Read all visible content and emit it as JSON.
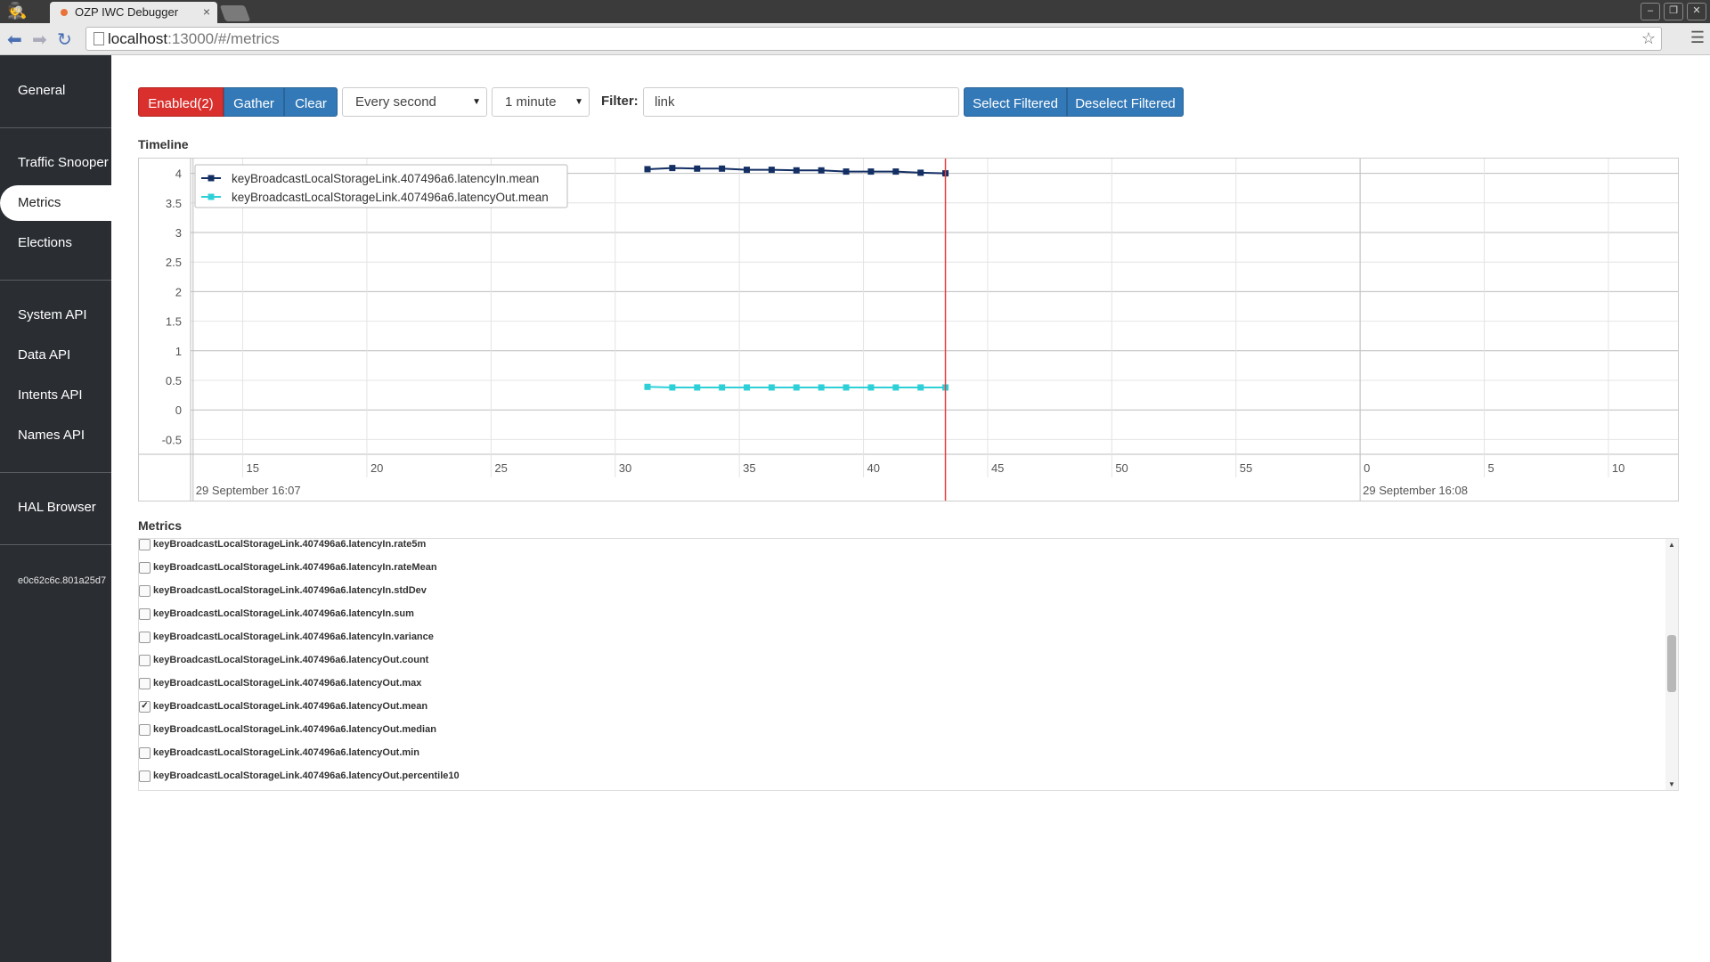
{
  "browser": {
    "tab_title": "OZP IWC Debugger",
    "tab_close": "×",
    "url_host": "localhost",
    "url_rest": ":13000/#/metrics"
  },
  "sidebar": {
    "items": [
      {
        "label": "General"
      },
      {
        "label": "Traffic Snooper"
      },
      {
        "label": "Metrics",
        "active": true
      },
      {
        "label": "Elections"
      },
      {
        "label": "System API"
      },
      {
        "label": "Data API"
      },
      {
        "label": "Intents API"
      },
      {
        "label": "Names API"
      },
      {
        "label": "HAL Browser"
      }
    ],
    "instance_id": "e0c62c6c.801a25d7"
  },
  "controls": {
    "enabled_label": "Enabled(2)",
    "gather_label": "Gather",
    "clear_label": "Clear",
    "interval_select": "Every second",
    "window_select": "1 minute",
    "filter_label": "Filter:",
    "filter_value": "link",
    "select_filtered_label": "Select Filtered",
    "deselect_filtered_label": "Deselect Filtered"
  },
  "sections": {
    "timeline_title": "Timeline",
    "metrics_title": "Metrics"
  },
  "metrics_list": [
    {
      "name": "keyBroadcastLocalStorageLink.407496a6.latencyIn.rate5m",
      "checked": false
    },
    {
      "name": "keyBroadcastLocalStorageLink.407496a6.latencyIn.rateMean",
      "checked": false
    },
    {
      "name": "keyBroadcastLocalStorageLink.407496a6.latencyIn.stdDev",
      "checked": false
    },
    {
      "name": "keyBroadcastLocalStorageLink.407496a6.latencyIn.sum",
      "checked": false
    },
    {
      "name": "keyBroadcastLocalStorageLink.407496a6.latencyIn.variance",
      "checked": false
    },
    {
      "name": "keyBroadcastLocalStorageLink.407496a6.latencyOut.count",
      "checked": false
    },
    {
      "name": "keyBroadcastLocalStorageLink.407496a6.latencyOut.max",
      "checked": false
    },
    {
      "name": "keyBroadcastLocalStorageLink.407496a6.latencyOut.mean",
      "checked": true
    },
    {
      "name": "keyBroadcastLocalStorageLink.407496a6.latencyOut.median",
      "checked": false
    },
    {
      "name": "keyBroadcastLocalStorageLink.407496a6.latencyOut.min",
      "checked": false
    },
    {
      "name": "keyBroadcastLocalStorageLink.407496a6.latencyOut.percentile10",
      "checked": false
    }
  ],
  "colors": {
    "series_in": "#132f63",
    "series_out": "#2ed0d8",
    "now_line": "#e83d3d"
  },
  "chart_data": {
    "type": "line",
    "title": "",
    "xlabel": "",
    "ylabel": "",
    "ylim": [
      -0.75,
      4.25
    ],
    "xlim": [
      12.9,
      72.8
    ],
    "y_ticks": [
      4,
      3.5,
      3,
      2.5,
      2,
      1.5,
      1,
      0.5,
      0,
      -0.5
    ],
    "x_ticks": [
      {
        "value": 15,
        "label": "15"
      },
      {
        "value": 20,
        "label": "20"
      },
      {
        "value": 25,
        "label": "25"
      },
      {
        "value": 30,
        "label": "30"
      },
      {
        "value": 35,
        "label": "35"
      },
      {
        "value": 40,
        "label": "40"
      },
      {
        "value": 45,
        "label": "45"
      },
      {
        "value": 50,
        "label": "50"
      },
      {
        "value": 55,
        "label": "55"
      },
      {
        "value": 60,
        "label": "0"
      },
      {
        "value": 65,
        "label": "5"
      },
      {
        "value": 70,
        "label": "10"
      }
    ],
    "major_ticks": [
      {
        "value": 13,
        "label": "29 September 16:07"
      },
      {
        "value": 60,
        "label": "29 September 16:08"
      }
    ],
    "now_marker": 43.3,
    "legend_position": "top-left",
    "grid": true,
    "series": [
      {
        "name": "keyBroadcastLocalStorageLink.407496a6.latencyIn.mean",
        "x": [
          31.3,
          32.3,
          33.3,
          34.3,
          35.3,
          36.3,
          37.3,
          38.3,
          39.3,
          40.3,
          41.3,
          42.3,
          43.3
        ],
        "y": [
          4.07,
          4.09,
          4.08,
          4.08,
          4.06,
          4.06,
          4.05,
          4.05,
          4.03,
          4.03,
          4.03,
          4.01,
          4.0
        ]
      },
      {
        "name": "keyBroadcastLocalStorageLink.407496a6.latencyOut.mean",
        "x": [
          31.3,
          32.3,
          33.3,
          34.3,
          35.3,
          36.3,
          37.3,
          38.3,
          39.3,
          40.3,
          41.3,
          42.3,
          43.3
        ],
        "y": [
          0.39,
          0.38,
          0.38,
          0.38,
          0.38,
          0.38,
          0.38,
          0.38,
          0.38,
          0.38,
          0.38,
          0.38,
          0.38
        ]
      }
    ]
  }
}
